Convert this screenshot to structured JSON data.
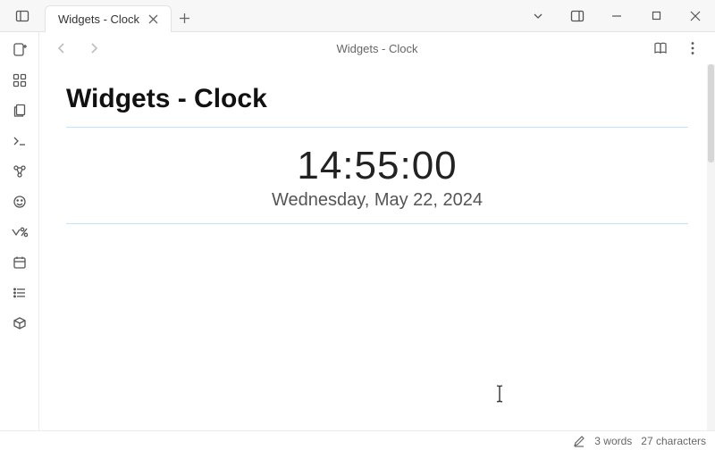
{
  "tab": {
    "title": "Widgets - Clock"
  },
  "subheader": {
    "title": "Widgets - Clock"
  },
  "document": {
    "heading": "Widgets - Clock",
    "clock": {
      "time": "14:55:00",
      "date": "Wednesday, May 22, 2024"
    }
  },
  "statusbar": {
    "words": "3 words",
    "chars": "27 characters"
  }
}
